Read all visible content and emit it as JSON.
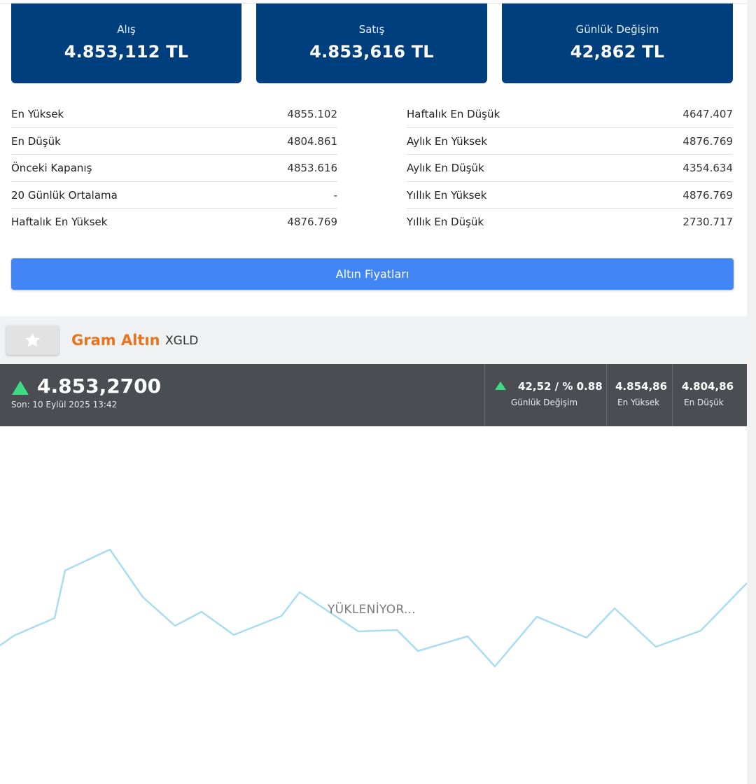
{
  "price_cards": [
    {
      "label": "Alış",
      "value": "4.853,112 TL"
    },
    {
      "label": "Satış",
      "value": "4.853,616 TL"
    },
    {
      "label": "Günlük Değişim",
      "value": "42,862 TL"
    }
  ],
  "stats_left": [
    {
      "label": "En Yüksek",
      "value": "4855.102"
    },
    {
      "label": "En Düşük",
      "value": "4804.861"
    },
    {
      "label": "Önceki Kapanış",
      "value": "4853.616"
    },
    {
      "label": "20 Günlük Ortalama",
      "value": "-"
    },
    {
      "label": "Haftalık En Yüksek",
      "value": "4876.769"
    }
  ],
  "stats_right": [
    {
      "label": "Haftalık En Düşük",
      "value": "4647.407"
    },
    {
      "label": "Aylık En Yüksek",
      "value": "4876.769"
    },
    {
      "label": "Aylık En Düşük",
      "value": "4354.634"
    },
    {
      "label": "Yıllık En Yüksek",
      "value": "4876.769"
    },
    {
      "label": "Yıllık En Düşük",
      "value": "2730.717"
    }
  ],
  "gold_prices_button": "Altın Fiyatları",
  "asset": {
    "name": "Gram Altın",
    "code": "XGLD"
  },
  "ticker": {
    "price": "4.853,2700",
    "last_update": "Son: 10 Eylül 2025 13:42",
    "daily_change": "42,52 / % 0.88",
    "daily_change_label": "Günlük Değişim",
    "high": "4.854,86",
    "high_label": "En Yüksek",
    "low": "4.804,86",
    "low_label": "En Düşük"
  },
  "loading_text": "YÜKLENİYOR...",
  "colors": {
    "card_blue": "#003f7e",
    "button_blue": "#4285f4",
    "asset_orange": "#e8741e",
    "ticker_bg": "#4a4d52",
    "up_green": "#3ddc84",
    "placeholder_line": "#a9dcf3"
  },
  "icons": {
    "favorite": "star-icon",
    "trend": "triangle-up-icon"
  }
}
